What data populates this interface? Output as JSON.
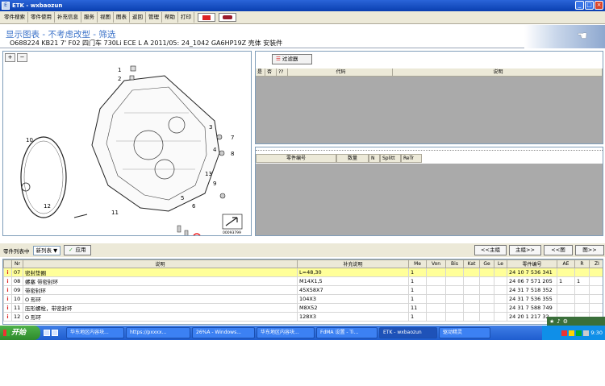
{
  "window": {
    "title": "ETK - wxbaozun",
    "app_icon": "etk-app-icon",
    "buttons": [
      "_",
      "□",
      "×"
    ]
  },
  "menu": {
    "items": [
      "零件搜索",
      "零件使用",
      "补充信息",
      "服务",
      "视图",
      "图表",
      "返回",
      "管理",
      "帮助",
      "打印"
    ],
    "flag_icons": [
      "flag-icon",
      "car-icon"
    ]
  },
  "header": {
    "title": "显示图表 - 不考虑改型 - 筛选",
    "subtitle": "O688224 KB21 7' F02 四门车 730Li ECE L A 2011/05: 24_1042 GA6HP19Z 壳体 安装件"
  },
  "drawing": {
    "zoom_in": "+",
    "zoom_out": "−",
    "labels": [
      "1",
      "2",
      "3",
      "4",
      "5",
      "6",
      "7",
      "8",
      "9",
      "10",
      "11",
      "12",
      "13"
    ],
    "image_id": "00093799"
  },
  "filter_panel": {
    "filter_button": "过滤器",
    "columns": [
      "是",
      "否",
      "??",
      "代码",
      "说明"
    ]
  },
  "parts_detail_panel": {
    "columns": [
      "零件编号",
      "数量",
      "N",
      "Splitt",
      "ReTr"
    ]
  },
  "parts_toolbar": {
    "label": "零件列表中",
    "select_value": "新列表",
    "apply_label": "应用",
    "nav_buttons": [
      "<<主组",
      "主组>>",
      "<<图",
      "图>>"
    ]
  },
  "parts_table": {
    "columns": [
      "",
      "Nr",
      "说明",
      "补充说明",
      "Me",
      "Von",
      "Bis",
      "Kat",
      "Ge",
      "Le",
      "零件编号",
      "AE",
      "R",
      "ZI"
    ],
    "rows": [
      {
        "info": "i",
        "nr": "07",
        "desc": "密封垫圈",
        "note": "L=48,30",
        "me": "1",
        "part": "24 10 7 536 341",
        "ae": "",
        "r": "",
        "selected": true
      },
      {
        "info": "i",
        "nr": "08",
        "desc": "螺塞 带密封环",
        "note": "M14X1,5",
        "me": "1",
        "part": "24 06 7 571 205",
        "ae": "1",
        "r": "1",
        "selected": false
      },
      {
        "info": "i",
        "nr": "09",
        "desc": "带密封环",
        "note": "45X58X7",
        "me": "1",
        "part": "24 31 7 518 352",
        "ae": "",
        "r": "",
        "selected": false
      },
      {
        "info": "i",
        "nr": "10",
        "desc": "O 形环",
        "note": "104X3",
        "me": "1",
        "part": "24 31 7 536 355",
        "ae": "",
        "r": "",
        "selected": false
      },
      {
        "info": "i",
        "nr": "11",
        "desc": "压形螺栓，带密封环",
        "note": "M8X52",
        "me": "11",
        "part": "24 31 7 588 749",
        "ae": "",
        "r": "",
        "selected": false
      },
      {
        "info": "i",
        "nr": "12",
        "desc": "O 形环",
        "note": "128X3",
        "me": "1",
        "part": "24 20 1 217 32",
        "ae": "",
        "r": "",
        "selected": false
      }
    ]
  },
  "taskbar": {
    "start": "开始",
    "tasks": [
      "华东地区内容块...",
      "https://pxxxx...",
      "26%A - Windows...",
      "华东地区内容块...",
      "FdMA 设置 - Ti...",
      "ETK - wxbaozun",
      "驱动精灵"
    ],
    "clock": "9:30"
  }
}
